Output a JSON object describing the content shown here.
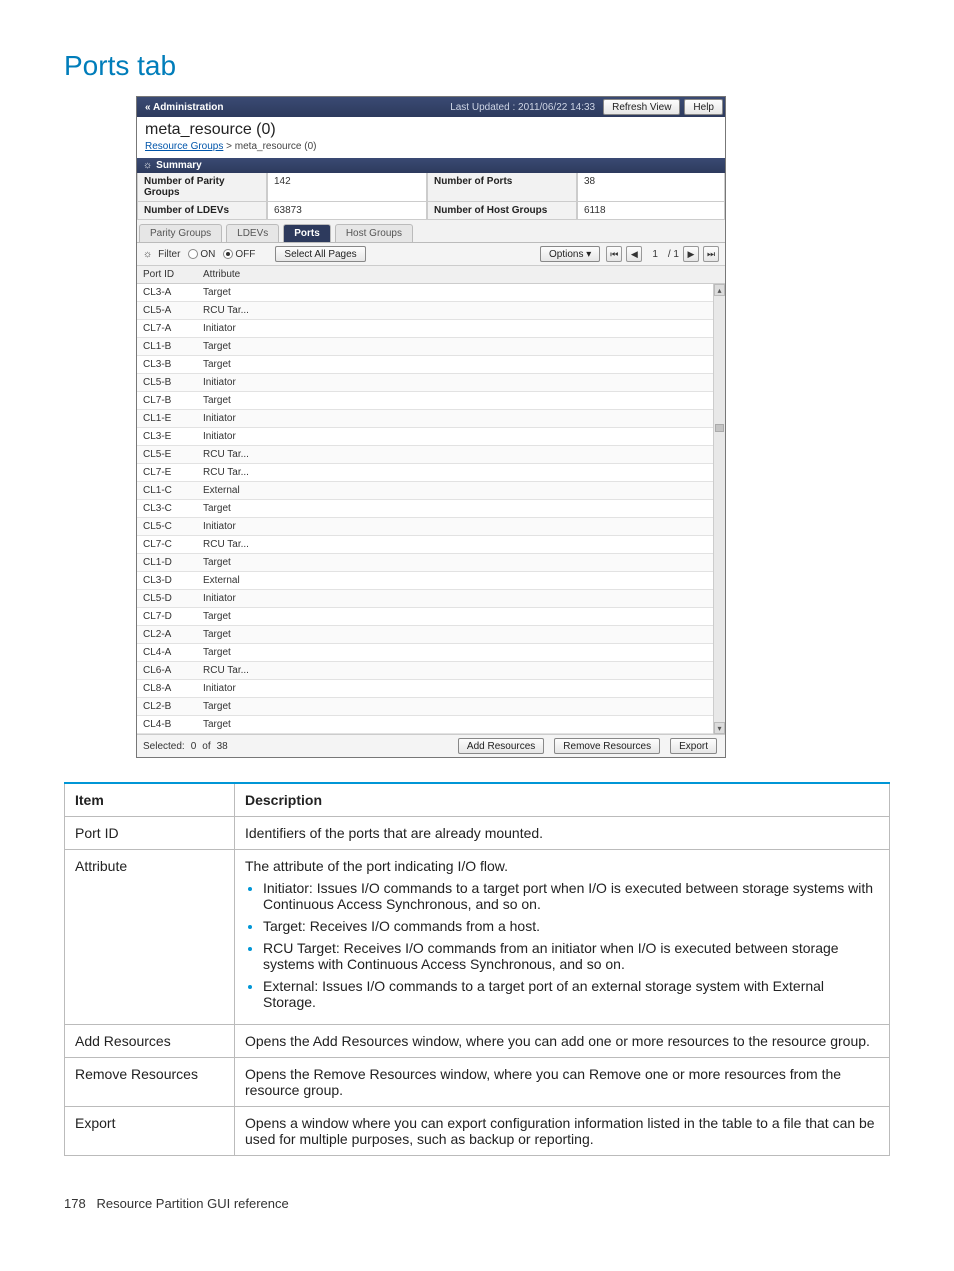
{
  "section_title": "Ports tab",
  "screenshot": {
    "titlebar": {
      "admin_label": "« Administration",
      "last_updated": "Last Updated : 2011/06/22 14:33",
      "refresh_btn": "Refresh View",
      "help_btn": "Help"
    },
    "crumb": {
      "title": "meta_resource (0)",
      "link": "Resource Groups",
      "sep": " > ",
      "current": "meta_resource (0)"
    },
    "summary": {
      "header": "Summary",
      "parity_label": "Number of Parity Groups",
      "parity_value": "142",
      "ports_label": "Number of Ports",
      "ports_value": "38",
      "ldevs_label": "Number of LDEVs",
      "ldevs_value": "63873",
      "hg_label": "Number of Host Groups",
      "hg_value": "6118"
    },
    "tabs": [
      "Parity Groups",
      "LDEVs",
      "Ports",
      "Host Groups"
    ],
    "filterbar": {
      "filter_label": "Filter",
      "on": "ON",
      "off": "OFF",
      "select_all": "Select All Pages",
      "options": "Options",
      "page": "1",
      "total": "/ 1"
    },
    "columns": [
      "Port ID",
      "Attribute"
    ],
    "rows": [
      {
        "id": "CL3-A",
        "attr": "Target"
      },
      {
        "id": "CL5-A",
        "attr": "RCU Tar..."
      },
      {
        "id": "CL7-A",
        "attr": "Initiator"
      },
      {
        "id": "CL1-B",
        "attr": "Target"
      },
      {
        "id": "CL3-B",
        "attr": "Target"
      },
      {
        "id": "CL5-B",
        "attr": "Initiator"
      },
      {
        "id": "CL7-B",
        "attr": "Target"
      },
      {
        "id": "CL1-E",
        "attr": "Initiator"
      },
      {
        "id": "CL3-E",
        "attr": "Initiator"
      },
      {
        "id": "CL5-E",
        "attr": "RCU Tar..."
      },
      {
        "id": "CL7-E",
        "attr": "RCU Tar..."
      },
      {
        "id": "CL1-C",
        "attr": "External"
      },
      {
        "id": "CL3-C",
        "attr": "Target"
      },
      {
        "id": "CL5-C",
        "attr": "Initiator"
      },
      {
        "id": "CL7-C",
        "attr": "RCU Tar..."
      },
      {
        "id": "CL1-D",
        "attr": "Target"
      },
      {
        "id": "CL3-D",
        "attr": "External"
      },
      {
        "id": "CL5-D",
        "attr": "Initiator"
      },
      {
        "id": "CL7-D",
        "attr": "Target"
      },
      {
        "id": "CL2-A",
        "attr": "Target"
      },
      {
        "id": "CL4-A",
        "attr": "Target"
      },
      {
        "id": "CL6-A",
        "attr": "RCU Tar..."
      },
      {
        "id": "CL8-A",
        "attr": "Initiator"
      },
      {
        "id": "CL2-B",
        "attr": "Target"
      },
      {
        "id": "CL4-B",
        "attr": "Target"
      }
    ],
    "status": {
      "selected_label": "Selected:",
      "selected_count": "0",
      "of": "of",
      "total": "38",
      "add_btn": "Add Resources",
      "remove_btn": "Remove Resources",
      "export_btn": "Export"
    }
  },
  "desc": {
    "headers": {
      "item": "Item",
      "description": "Description"
    },
    "rows": {
      "port_id": {
        "item": "Port ID",
        "desc": "Identifiers of the ports that are already mounted."
      },
      "attribute": {
        "item": "Attribute",
        "intro": "The attribute of the port indicating I/O flow.",
        "bullets": [
          "Initiator: Issues I/O commands to a target port when I/O is executed between storage systems with Continuous Access Synchronous, and so on.",
          "Target: Receives I/O commands from a host.",
          "RCU Target: Receives I/O commands from an initiator when I/O is executed between storage systems with Continuous Access Synchronous, and so on.",
          "External: Issues I/O commands to a target port of an external storage system with External Storage."
        ]
      },
      "add": {
        "item": "Add Resources",
        "desc": "Opens the Add Resources window, where you can add one or more resources to the resource group."
      },
      "remove": {
        "item": "Remove Resources",
        "desc": "Opens the Remove Resources window, where you can Remove one or more resources from the resource group."
      },
      "export": {
        "item": "Export",
        "desc": "Opens a window where you can export configuration information listed in the table to a file that can be used for multiple purposes, such as backup or reporting."
      }
    }
  },
  "footer": {
    "page": "178",
    "label": "Resource Partition GUI reference"
  }
}
